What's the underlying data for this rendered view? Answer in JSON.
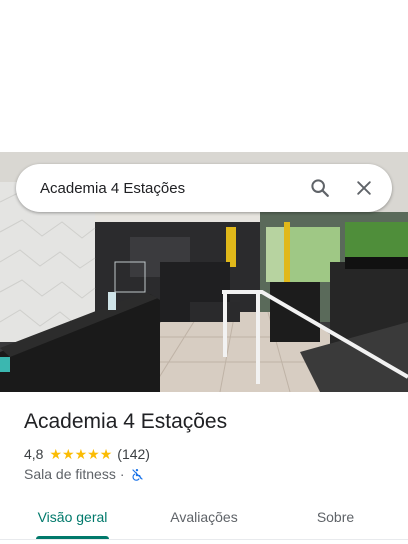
{
  "search": {
    "query": "Academia 4 Estações",
    "search_icon": "search-icon",
    "close_icon": "close-icon"
  },
  "hero": {
    "image_description_icon": "photo"
  },
  "place": {
    "title": "Academia 4 Estações",
    "rating": "4,8",
    "stars": 5,
    "review_count": "(142)",
    "category": "Sala de fitness",
    "separator": "·",
    "accessibility_icon": "not-accessible-icon"
  },
  "tabs": [
    {
      "label": "Visão geral",
      "active": true
    },
    {
      "label": "Avaliações",
      "active": false
    },
    {
      "label": "Sobre",
      "active": false
    }
  ],
  "colors": {
    "accent": "#00796b",
    "star": "#fbbc04",
    "access_icon": "#1a73e8"
  }
}
